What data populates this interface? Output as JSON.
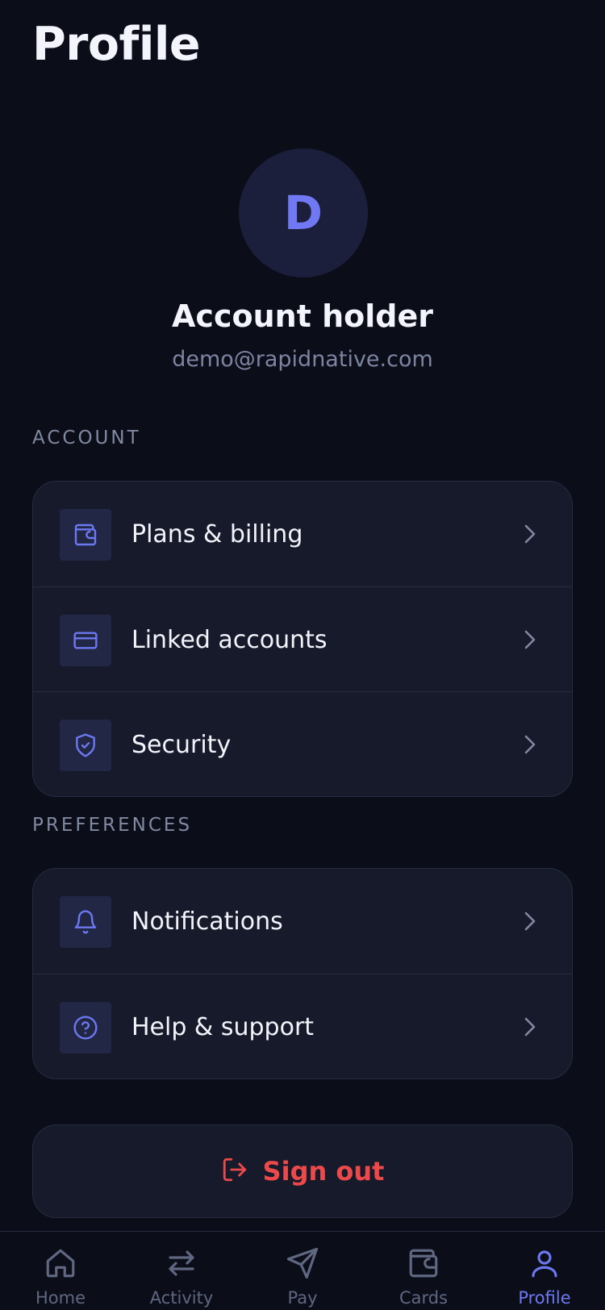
{
  "header": {
    "title": "Profile"
  },
  "profile": {
    "avatar_initial": "D",
    "name": "Account holder",
    "email": "demo@rapidnative.com"
  },
  "sections": {
    "account": {
      "label": "ACCOUNT",
      "items": [
        {
          "label": "Plans & billing",
          "icon": "wallet-icon"
        },
        {
          "label": "Linked accounts",
          "icon": "credit-card-icon"
        },
        {
          "label": "Security",
          "icon": "shield-check-icon"
        }
      ]
    },
    "preferences": {
      "label": "PREFERENCES",
      "items": [
        {
          "label": "Notifications",
          "icon": "bell-icon"
        },
        {
          "label": "Help & support",
          "icon": "help-circle-icon"
        }
      ]
    }
  },
  "signout": {
    "label": "Sign out",
    "icon": "log-out-icon"
  },
  "tabbar": {
    "active": "Profile",
    "tabs": [
      {
        "label": "Home",
        "icon": "home-icon"
      },
      {
        "label": "Activity",
        "icon": "arrows-exchange-icon"
      },
      {
        "label": "Pay",
        "icon": "send-icon"
      },
      {
        "label": "Cards",
        "icon": "wallet-icon"
      },
      {
        "label": "Profile",
        "icon": "user-icon"
      }
    ]
  },
  "colors": {
    "background": "#0b0e19",
    "card": "#161a2b",
    "accent": "#6c78f0",
    "danger": "#ec4a4a",
    "muted": "#7c84a2"
  }
}
